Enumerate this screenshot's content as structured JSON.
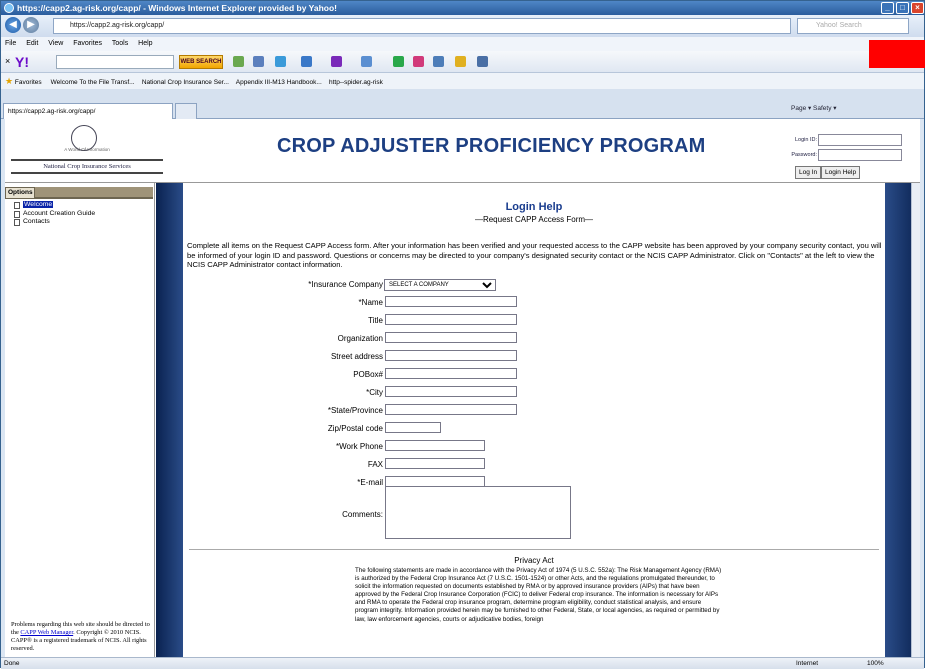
{
  "window": {
    "title": "https://capp2.ag-risk.org/capp/ - Windows Internet Explorer provided by Yahoo!",
    "address": "https://capp2.ag-risk.org/capp/",
    "search_placeholder": "Yahoo! Search"
  },
  "menu": [
    "File",
    "Edit",
    "View",
    "Favorites",
    "Tools",
    "Help"
  ],
  "toolbar": {
    "web_search": "WEB SEARCH"
  },
  "favorites": {
    "label": "Favorites",
    "items": [
      "Welcome To the File Transf...",
      "National Crop Insurance Ser...",
      "Appendix III-M13 Handbook...",
      "http--spider.ag-risk"
    ]
  },
  "tab": {
    "label": "https://capp2.ag-risk.org/capp/"
  },
  "commandbar": "Page ▾  Safety ▾",
  "header": {
    "logo_text": "National Crop Insurance Services",
    "logo_tag": "A World Of Information",
    "title": "CROP ADJUSTER PROFICIENCY PROGRAM",
    "login_id_label": "Login ID:",
    "password_label": "Password:",
    "login_button": "Log In",
    "help_button": "Login Help"
  },
  "sidebar": {
    "tab": "Options",
    "items": [
      "Welcome",
      "Account Creation Guide",
      "Contacts"
    ],
    "note_1": "Problems regarding this web site should be directed to the ",
    "note_link": "CAPP Web Manager",
    "note_2": ". Copyright © 2010 NCIS. CAPP® is a registered trademark of NCIS. All rights reserved."
  },
  "main": {
    "title": "Login Help",
    "subtitle": "—Request CAPP Access Form—",
    "intro": "Complete all items on the Request CAPP Access form. After your information has been verified and your requested access to the CAPP website has been approved by your company security contact, you will be informed of your login ID and password. Questions or concerns may be directed to your company's designated security contact or the NCIS CAPP Administrator. Click on \"Contacts\" at the left to view the NCIS CAPP Administrator contact information.",
    "fields": {
      "company": "*Insurance Company",
      "company_value": "SELECT A COMPANY",
      "name": "*Name",
      "title": "Title",
      "organization": "Organization",
      "street": "Street address",
      "pobox": "POBox#",
      "city": "*City",
      "state": "*State/Province",
      "zip": "Zip/Postal code",
      "work_phone": "*Work Phone",
      "fax": "FAX",
      "email": "*E-mail",
      "comments": "Comments:"
    },
    "privacy_title": "Privacy Act",
    "privacy_text": "The following statements are made in accordance with the Privacy Act of 1974 (5 U.S.C. 552a): The Risk Management Agency (RMA) is authorized by the Federal Crop Insurance Act (7 U.S.C. 1501-1524) or other Acts, and the regulations promulgated thereunder, to solicit the information requested on documents established by RMA or by approved insurance providers (AIPs) that have been approved by the Federal Crop Insurance Corporation (FCIC) to deliver Federal crop insurance. The information is necessary for AIPs and RMA to operate the Federal crop insurance program, determine program eligibility, conduct statistical analysis, and ensure program integrity. Information provided herein may be furnished to other Federal, State, or local agencies, as required or permitted by law, law enforcement agencies, courts or adjudicative bodies, foreign"
  },
  "status": {
    "left": "Done",
    "zone": "Internet",
    "zoom": "100%"
  }
}
